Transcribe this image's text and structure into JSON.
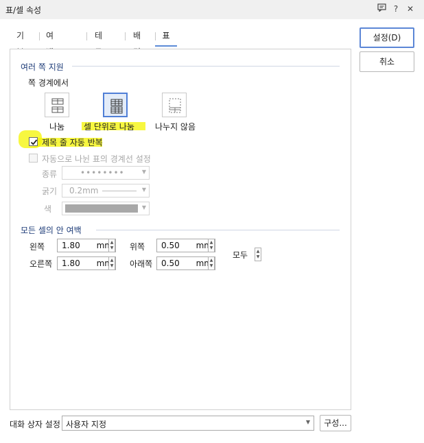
{
  "window": {
    "title": "표/셀 속성",
    "icons": [
      "comment-icon",
      "help-icon",
      "close-icon"
    ],
    "help_glyph": "?",
    "close_glyph": "✕"
  },
  "tabs": [
    {
      "label": "기본"
    },
    {
      "label": "여백/캡션"
    },
    {
      "label": "테두리"
    },
    {
      "label": "배경"
    },
    {
      "label": "표"
    }
  ],
  "split": {
    "section_title": "여러 쪽 지원",
    "subtitle": "쪽 경계에서",
    "options": [
      {
        "label": "나눔",
        "selected": false
      },
      {
        "label": "셀 단위로 나눔",
        "selected": true
      },
      {
        "label": "나누지 않음",
        "selected": false
      }
    ]
  },
  "repeat_header": {
    "label": "제목 줄 자동 반복",
    "checked": true
  },
  "auto_border": {
    "label": "자동으로 나뉜 표의 경계선 설정",
    "checked": false,
    "type_label": "종류",
    "type_value": "••••••••",
    "thickness_label": "굵기",
    "thickness_value": "0.2mm",
    "color_label": "색"
  },
  "padding": {
    "section_title": "모든 셀의 안 여백",
    "left": {
      "label": "왼쪽",
      "value": "1.80",
      "unit": "mm"
    },
    "right": {
      "label": "오른쪽",
      "value": "1.80",
      "unit": "mm"
    },
    "top": {
      "label": "위쪽",
      "value": "0.50",
      "unit": "mm"
    },
    "bottom": {
      "label": "아래쪽",
      "value": "0.50",
      "unit": "mm"
    },
    "all_label": "모두"
  },
  "buttons": {
    "ok": "설정(D)",
    "cancel": "취소",
    "config": "구성..."
  },
  "footer": {
    "label": "대화 상자 설정",
    "value": "사용자 지정"
  },
  "colors": {
    "accent": "#5b86d6",
    "highlight": "#f4f400",
    "section_title": "#1e3c78"
  }
}
